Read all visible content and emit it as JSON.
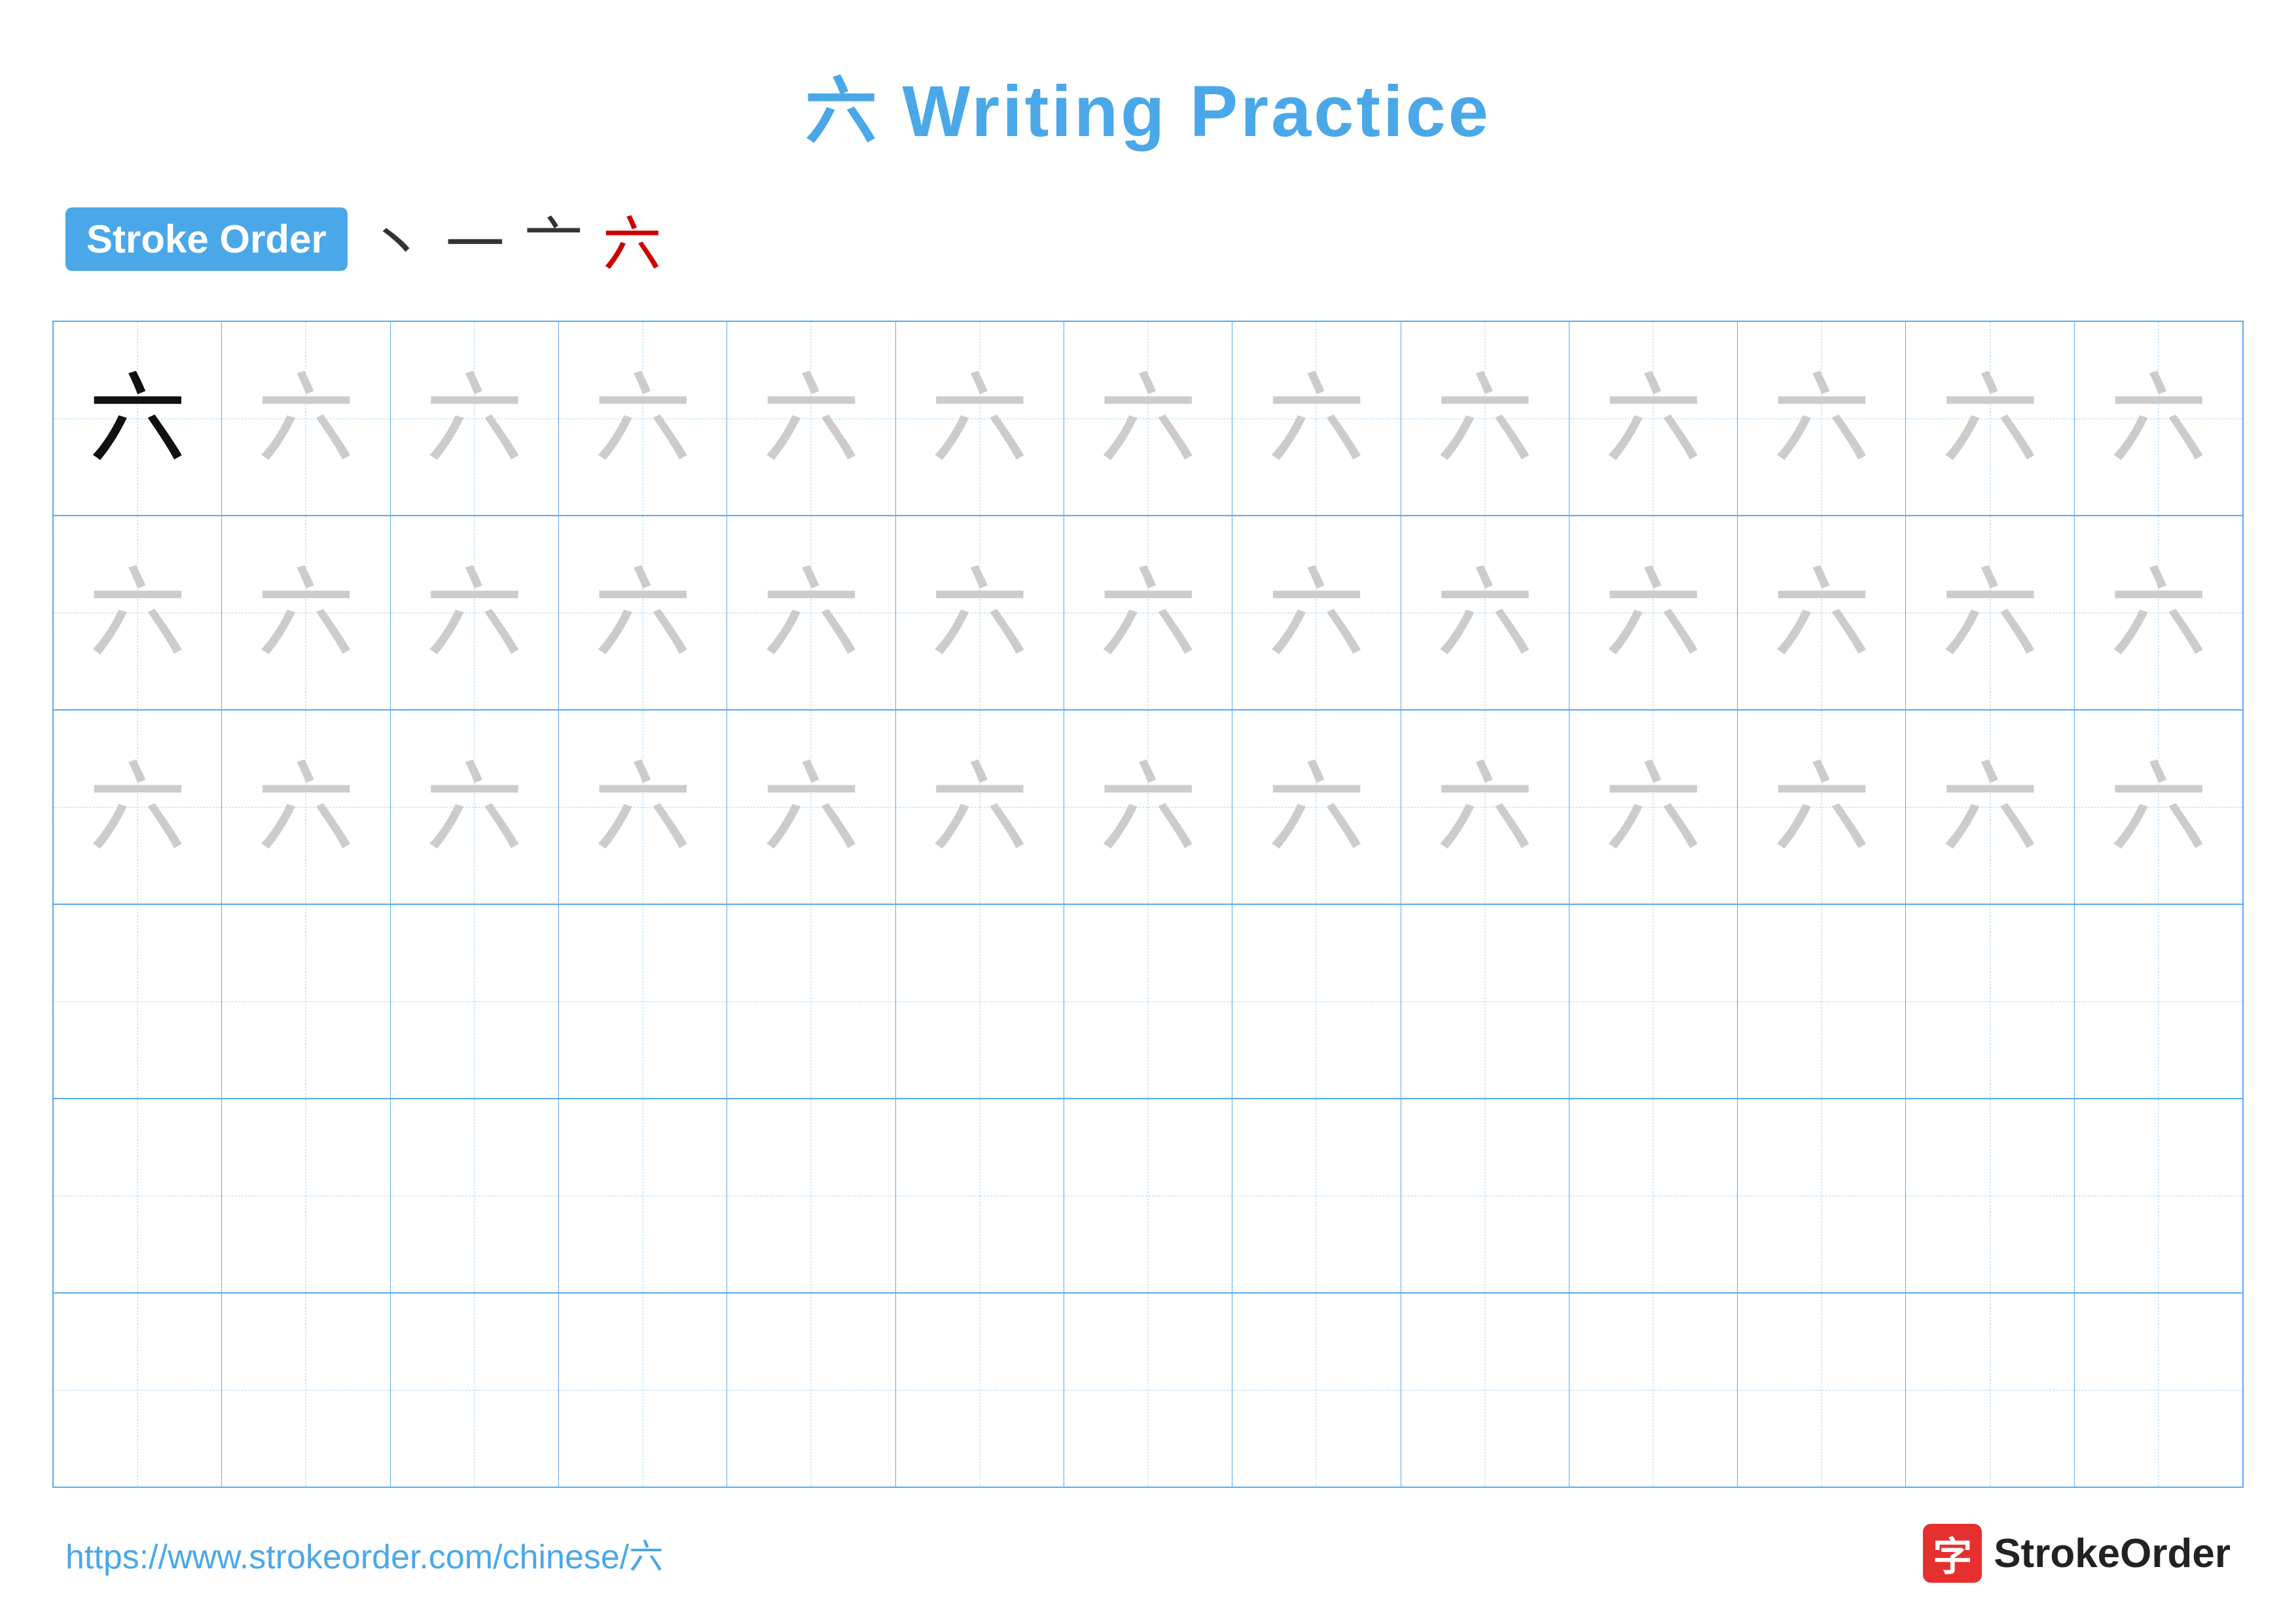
{
  "title": {
    "character": "六",
    "label": "Writing Practice",
    "full": "六 Writing Practice"
  },
  "stroke_order": {
    "badge": "Stroke Order",
    "strokes": [
      "丶",
      "一",
      "亠",
      "六"
    ]
  },
  "grid": {
    "rows": 6,
    "cols": 13,
    "practice_rows_with_ghost": 3,
    "blank_rows": 3,
    "character": "六"
  },
  "footer": {
    "url": "https://www.strokeorder.com/chinese/六",
    "logo_icon": "字",
    "logo_text": "StrokeOrder"
  }
}
